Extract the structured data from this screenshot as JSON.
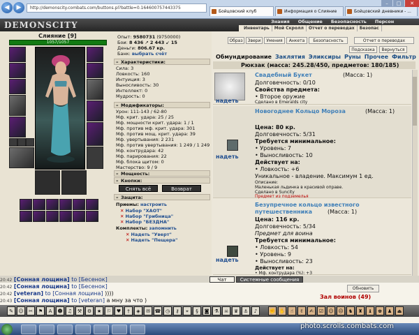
{
  "browser": {
    "url": "http://demonscity.combats.com/buttons.pl?battle=0.164600757443375",
    "tabs": [
      "Бойцовский клуб",
      "Информация о Слияние",
      "Бойцовский дневники - ..."
    ]
  },
  "header": {
    "logo": "DEMONSCITY",
    "menu_top": [
      "Знания",
      "Общение",
      "Безопасность",
      "Персон"
    ],
    "menu_bottom": [
      "Инвентарь",
      "Мой Скролл",
      "Отчет о переводах",
      "Безопас"
    ]
  },
  "character": {
    "name": "Слияние [9]",
    "hp": "1057/1057",
    "exp_label": "Опыт:",
    "exp": "9580731",
    "exp_next": "(9750000)",
    "battles_label": "Бои:",
    "battles": "8 436",
    "wins": "2 443",
    "draws": "15",
    "money_label": "Деньги:",
    "money": "806.67 кр.",
    "bank_label": "Банк:",
    "bank_link": "выбрать счёт"
  },
  "stats": {
    "title": "Характеристики:",
    "rows": [
      "Сила: 3",
      "Ловкость: 160",
      "Интуиция: 3",
      "Выносливость: 30",
      "Интеллект: 0",
      "Мудрость: 0"
    ]
  },
  "modifiers": {
    "title": "Модификаторы:",
    "rows": [
      "Урон: 111-143 / 62-80",
      "Мф. крит. удара: 25 / 25",
      "Мф. мощности крит. удара: 1 / 1",
      "Мф. против мф. крит. удара: 301",
      "Мф. против мощ. крит. удара: 39",
      "Мф. увертывания: 2 231",
      "Мф. против увертывания: 1 249 / 1 249",
      "Мф. контрудара: 42",
      "Мф. парирования: 22",
      "Мф. блока щитом: 0",
      "Мастерство: 9 / 9"
    ]
  },
  "sections": {
    "power": "Мощность:",
    "buttons": "Кнопки:",
    "protection": "Защита:",
    "techniques": "Приемы:",
    "sets": "Комплекты:"
  },
  "actions": {
    "undress": "Снять всё",
    "return": "Возврат",
    "configure": "настроить",
    "remember": "запомнить"
  },
  "techniques": [
    "Набор \"ХАОТ\"",
    "Набор \"Грибница\"",
    "Набор \"БЕЗДНА\""
  ],
  "sets": [
    "Надеть \"Уверт\"",
    "Надеть \"Пещера\""
  ],
  "right_buttons": [
    "Образ",
    "Звери",
    "Умения",
    "Анкета",
    "Безопасность",
    "Отчет о переводах",
    "Подсказка",
    "Вернуться"
  ],
  "categories": [
    "Обмундирование",
    "Заклятия",
    "Эликсиры",
    "Руны",
    "Прочее",
    "Фильтр"
  ],
  "backpack": "Рюкзак (масса: 245.28/450, предметов: 180/185)",
  "items": [
    {
      "name": "Свадебный Букет",
      "mass": "(Масса: 1)",
      "lines": [
        "Долговечность: 0/10",
        "Свойства предмета:",
        "• Второе оружие",
        "Сделано в Emeralds city"
      ],
      "wear": "надеть"
    },
    {
      "name": "Новогоднее Кольцо Мороза",
      "mass": "(Масса: 1)",
      "lines": [
        "Цена: 80 кр.",
        "Долговечность: 5/31",
        "Требуется минимальное:",
        "• Уровень: 7",
        "• Выносливость: 10",
        "Действует на:",
        "• Ловкость: +6",
        "Уникальное - владение. Максимум 1 ед.",
        "Описание:",
        "Маленькая льдинка в красивой оправе.",
        "Сделано в Suncity",
        "Предмет из подземелья"
      ],
      "wear": "надеть"
    },
    {
      "name": "Безупречное кольцо известного",
      "name2": "путешественника",
      "mass": "(Масса: 1)",
      "lines": [
        "Цена: 116 кр.",
        "Долговечность: 5/34",
        "Предмет для воина",
        "Требуется минимальное:",
        "• Ловкость: 54",
        "• Уровень: 9",
        "• Выносливость: 23",
        "Действует на:",
        "• Мф. контрудара (%): +3"
      ],
      "wear": "надеть"
    }
  ],
  "chat": {
    "tabs": [
      "Чат",
      "Системные сообщения"
    ],
    "lines": [
      {
        "time": "20:42",
        "loc": "[Сонная лощина]",
        "to": "to [Бесенок]",
        "msg": ""
      },
      {
        "time": "20:42",
        "loc": "[Сонная лощина]",
        "to": "to [Бесенок]",
        "msg": ""
      },
      {
        "time": "20:42",
        "loc": "[veteran]",
        "to": "to [Сонная лощина]",
        "msg": "))))"
      },
      {
        "time": "20:43",
        "loc": "[Сонная лощина]",
        "to": "to [veteran]",
        "msg": "а мну за что )"
      }
    ],
    "refresh": "Обновить",
    "hall": "Зал воинов (49)"
  },
  "watermark": "photo.scrolls.combats.com",
  "colors": {
    "link": "#1f4d8f",
    "item_name": "#3f7fb8",
    "hp": "#127a12",
    "hall": "#b00000"
  }
}
